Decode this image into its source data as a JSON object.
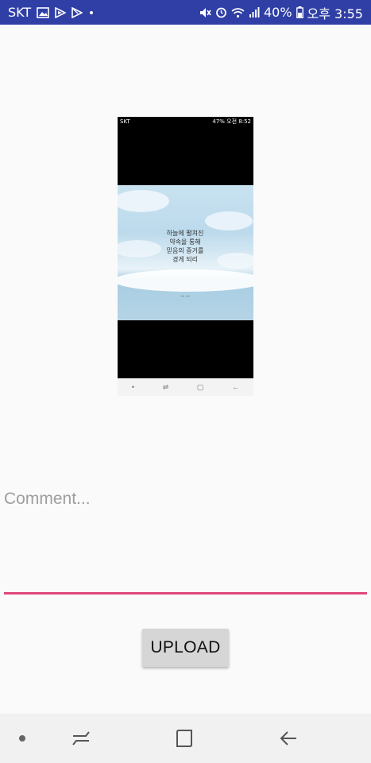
{
  "status_bar": {
    "carrier": "SKT",
    "battery": "40%",
    "time": "오후 3:55",
    "icons": [
      "gallery-icon",
      "flipboard-icon",
      "play-store-icon",
      "dot-icon",
      "mute-icon",
      "alarm-icon",
      "wifi-icon",
      "signal-icon",
      "battery-icon"
    ]
  },
  "preview": {
    "status_left": "SKT",
    "status_right": "47% 오전 8:52",
    "caption_lines": [
      "하늘에 펼쳐진",
      "약속을 통해",
      "믿음의 증거를",
      "경게 되리",
      "— —"
    ]
  },
  "comment": {
    "placeholder": "Comment...",
    "value": "",
    "underline_color": "#e0487a"
  },
  "upload": {
    "label": "UPLOAD"
  },
  "nav_bar": {
    "items": [
      "dot-icon",
      "recent-apps-icon",
      "home-icon",
      "back-icon"
    ]
  },
  "colors": {
    "status_bar": "#2f3fa6",
    "background": "#fafafa",
    "button": "#d6d6d6",
    "accent": "#e0487a"
  }
}
